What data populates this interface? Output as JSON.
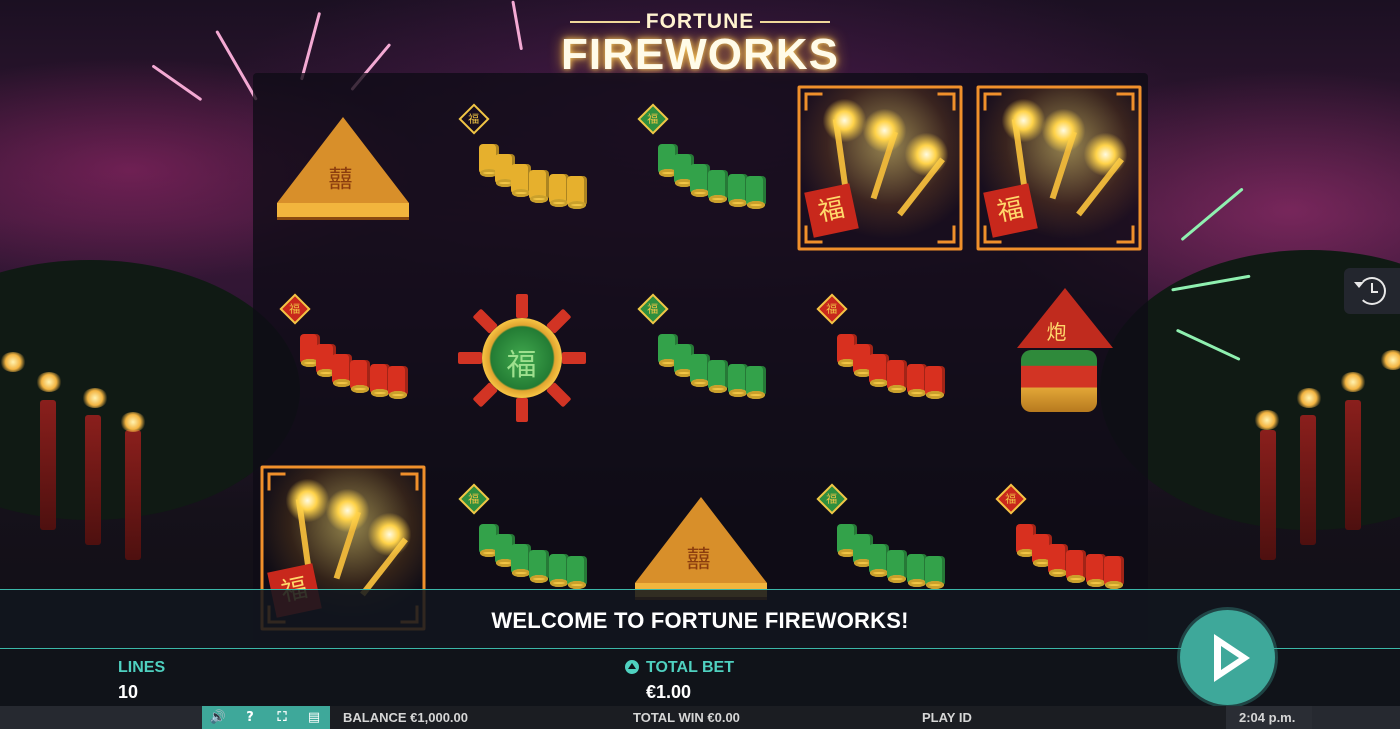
{
  "game": {
    "logo_top": "FORTUNE",
    "logo_main": "FIREWORKS"
  },
  "banner": {
    "message": "WELCOME TO FORTUNE FIREWORKS!"
  },
  "reels": {
    "columns": 5,
    "rows": 3,
    "grid": [
      [
        "pyramid-box",
        "gold-firecrackers",
        "green-firecrackers",
        "sparkler-wild",
        "sparkler-wild"
      ],
      [
        "red-firecrackers",
        "firework-wheel",
        "green-firecrackers",
        "red-firecrackers",
        "rocket"
      ],
      [
        "sparkler-wild",
        "green-firecrackers",
        "pyramid-box",
        "green-firecrackers",
        "red-firecrackers"
      ]
    ]
  },
  "controls": {
    "lines_label": "LINES",
    "lines_value": "10",
    "total_bet_label": "TOTAL BET",
    "total_bet_value": "€1.00",
    "spin_icon": "play-icon",
    "history_icon": "history-clock-icon"
  },
  "status_bar": {
    "balance": "BALANCE €1,000.00",
    "total_win": "TOTAL WIN €0.00",
    "play_id": "PLAY ID",
    "time": "2:04 p.m.",
    "tools": [
      "sound-icon",
      "help-icon",
      "fullscreen-icon",
      "paytable-icon"
    ],
    "tool_glyphs": [
      "🔊",
      "?",
      "⛶",
      "▤"
    ]
  },
  "colors": {
    "accent": "#3ea89a",
    "label": "#4fd1c0",
    "wild_frame": "#f0902b"
  }
}
